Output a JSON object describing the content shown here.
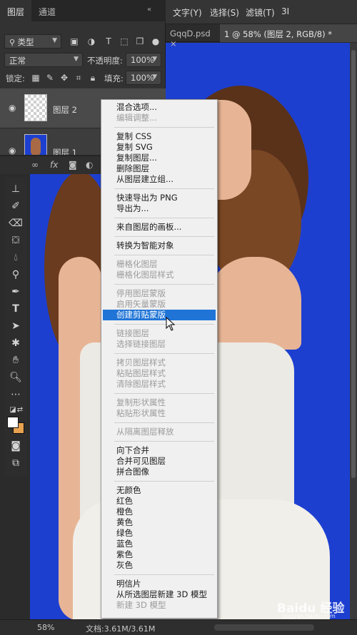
{
  "menubar": {
    "items": [
      "文字(Y)",
      "选择(S)",
      "滤镜(T)",
      "3I"
    ]
  },
  "doc_tabs": [
    {
      "label": "GqqD.psd ×",
      "active": false
    },
    {
      "label": "1 @ 58% (图层 2, RGB/8) *",
      "active": true
    }
  ],
  "layers_panel": {
    "tabs": [
      {
        "label": "图层",
        "active": true
      },
      {
        "label": "通道",
        "active": false
      }
    ],
    "filter_kind": "类型",
    "blend_mode": "正常",
    "opacity_label": "不透明度:",
    "opacity_value": "100%",
    "lock_label": "锁定:",
    "fill_label": "填充:",
    "fill_value": "100%",
    "layers": [
      {
        "name": "图层 2",
        "visible": true,
        "selected": true
      },
      {
        "name": "图层 1",
        "visible": true,
        "selected": false
      }
    ],
    "footer_icons": [
      "link-icon",
      "fx-icon",
      "mask-icon",
      "adjustment-icon"
    ]
  },
  "context_menu": {
    "groups": [
      [
        {
          "label": "混合选项...",
          "disabled": false
        },
        {
          "label": "编辑调整...",
          "disabled": true
        }
      ],
      [
        {
          "label": "复制 CSS",
          "disabled": false
        },
        {
          "label": "复制 SVG",
          "disabled": false
        },
        {
          "label": "复制图层...",
          "disabled": false
        },
        {
          "label": "删除图层",
          "disabled": false
        },
        {
          "label": "从图层建立组...",
          "disabled": false
        }
      ],
      [
        {
          "label": "快速导出为 PNG",
          "disabled": false
        },
        {
          "label": "导出为...",
          "disabled": false
        }
      ],
      [
        {
          "label": "来自图层的画板...",
          "disabled": false
        }
      ],
      [
        {
          "label": "转换为智能对象",
          "disabled": false
        }
      ],
      [
        {
          "label": "栅格化图层",
          "disabled": true
        },
        {
          "label": "栅格化图层样式",
          "disabled": true
        }
      ],
      [
        {
          "label": "停用图层蒙版",
          "disabled": true
        },
        {
          "label": "启用矢量蒙版",
          "disabled": true
        },
        {
          "label": "创建剪贴蒙版",
          "disabled": false,
          "highlighted": true
        }
      ],
      [
        {
          "label": "链接图层",
          "disabled": true
        },
        {
          "label": "选择链接图层",
          "disabled": true
        }
      ],
      [
        {
          "label": "拷贝图层样式",
          "disabled": true
        },
        {
          "label": "粘贴图层样式",
          "disabled": true
        },
        {
          "label": "清除图层样式",
          "disabled": true
        }
      ],
      [
        {
          "label": "复制形状属性",
          "disabled": true
        },
        {
          "label": "粘贴形状属性",
          "disabled": true
        }
      ],
      [
        {
          "label": "从隔离图层释放",
          "disabled": true
        }
      ],
      [
        {
          "label": "向下合并",
          "disabled": false
        },
        {
          "label": "合并可见图层",
          "disabled": false
        },
        {
          "label": "拼合图像",
          "disabled": false
        }
      ],
      [
        {
          "label": "无颜色",
          "disabled": false
        },
        {
          "label": "红色",
          "disabled": false
        },
        {
          "label": "橙色",
          "disabled": false
        },
        {
          "label": "黄色",
          "disabled": false
        },
        {
          "label": "绿色",
          "disabled": false
        },
        {
          "label": "蓝色",
          "disabled": false
        },
        {
          "label": "紫色",
          "disabled": false
        },
        {
          "label": "灰色",
          "disabled": false
        }
      ],
      [
        {
          "label": "明信片",
          "disabled": false
        },
        {
          "label": "从所选图层新建 3D 模型",
          "disabled": false
        },
        {
          "label": "新建 3D 模型",
          "disabled": true
        }
      ]
    ]
  },
  "statusbar": {
    "zoom": "58%",
    "doc": "文档:3.61M/3.61M"
  },
  "watermark": {
    "brand": "Baidu 经验",
    "site": "jingyan.baidu.com"
  },
  "colors": {
    "canvas_bg": "#1d3fd0",
    "menu_highlight": "#1f74d6",
    "foreground_color": "#ffffff",
    "background_color": "#e8a24f"
  }
}
